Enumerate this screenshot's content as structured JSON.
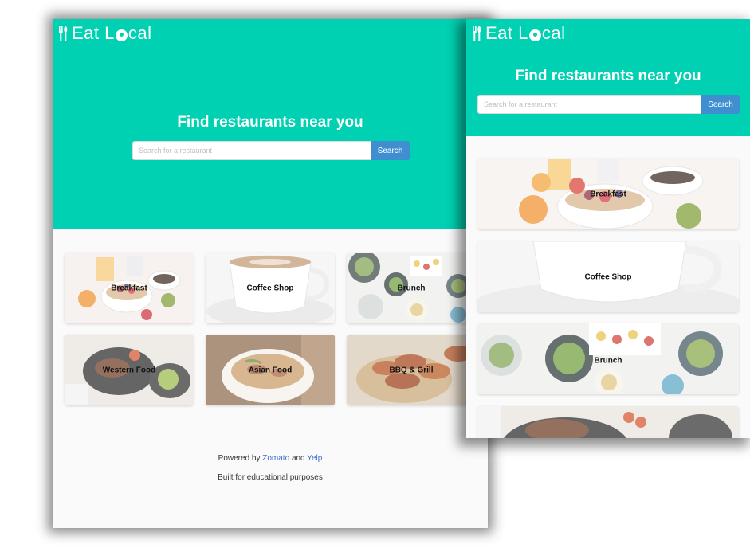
{
  "brand": {
    "name_a": "Eat L",
    "name_b": "cal"
  },
  "hero": {
    "title": "Find restaurants near you",
    "search_placeholder": "Search for a restaurant",
    "search_button": "Search"
  },
  "categories": [
    {
      "label": "Breakfast"
    },
    {
      "label": "Coffee Shop"
    },
    {
      "label": "Brunch"
    },
    {
      "label": "Western Food"
    },
    {
      "label": "Asian Food"
    },
    {
      "label": "BBQ & Grill"
    }
  ],
  "footer": {
    "powered_prefix": "Powered by",
    "zomato": "Zomato",
    "and": "and",
    "yelp": "Yelp",
    "built": "Built for educational purposes"
  },
  "colors": {
    "accent": "#00d1b2",
    "button": "#3e8ed0",
    "link": "#3e6bd0"
  }
}
